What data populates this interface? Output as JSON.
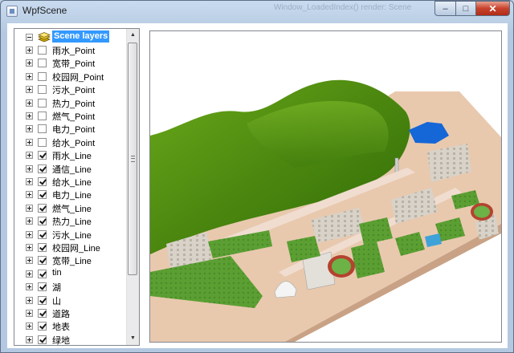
{
  "window": {
    "title": "WpfScene",
    "ghost_title": "Window_LoadedIndex() render: Scene",
    "buttons": {
      "minimize": "–",
      "maximize": "□",
      "close": "✕"
    }
  },
  "tree": {
    "root_label": "Scene layers",
    "items": [
      {
        "label": "雨水_Point",
        "checked": false
      },
      {
        "label": "宽带_Point",
        "checked": false
      },
      {
        "label": "校园网_Point",
        "checked": false
      },
      {
        "label": "污水_Point",
        "checked": false
      },
      {
        "label": "热力_Point",
        "checked": false
      },
      {
        "label": "燃气_Point",
        "checked": false
      },
      {
        "label": "电力_Point",
        "checked": false
      },
      {
        "label": "给水_Point",
        "checked": false
      },
      {
        "label": "雨水_Line",
        "checked": true
      },
      {
        "label": "通信_Line",
        "checked": true
      },
      {
        "label": "给水_Line",
        "checked": true
      },
      {
        "label": "电力_Line",
        "checked": true
      },
      {
        "label": "燃气_Line",
        "checked": true
      },
      {
        "label": "热力_Line",
        "checked": true
      },
      {
        "label": "污水_Line",
        "checked": true
      },
      {
        "label": "校园网_Line",
        "checked": true
      },
      {
        "label": "宽带_Line",
        "checked": true
      },
      {
        "label": "tin",
        "checked": true
      },
      {
        "label": "湖",
        "checked": true
      },
      {
        "label": "山",
        "checked": true
      },
      {
        "label": "道路",
        "checked": true
      },
      {
        "label": "地表",
        "checked": true
      },
      {
        "label": "绿地",
        "checked": true
      }
    ]
  },
  "colors": {
    "selection": "#3399ff",
    "terrain_green": "#4e8a10",
    "lake_blue": "#1566d6",
    "ground_tan": "#e8c9ae"
  },
  "icons": {
    "layers": "layers-icon",
    "expander": "plus-expander-icon",
    "scroll_up": "arrow-up-icon",
    "scroll_down": "arrow-down-icon"
  }
}
